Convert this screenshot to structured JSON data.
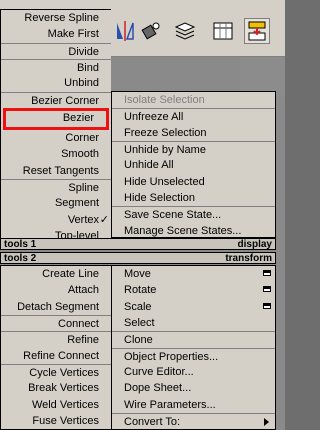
{
  "quad_menu": {
    "top_left": {
      "items": [
        {
          "label": "Reverse Spline"
        },
        {
          "label": "Make First"
        },
        {
          "label": "Divide"
        },
        {
          "label": "Bind"
        },
        {
          "label": "Unbind"
        },
        {
          "label": "Bezier Corner"
        },
        {
          "label": "Bezier"
        },
        {
          "label": "Corner"
        },
        {
          "label": "Smooth"
        },
        {
          "label": "Reset Tangents"
        },
        {
          "label": "Spline"
        },
        {
          "label": "Segment"
        },
        {
          "label": "Vertex",
          "check": "✓"
        },
        {
          "label": "Top-level"
        }
      ]
    },
    "top_right": {
      "items": [
        {
          "label": "Isolate Selection"
        },
        {
          "label": "Unfreeze All"
        },
        {
          "label": "Freeze Selection"
        },
        {
          "label": "Unhide by Name"
        },
        {
          "label": "Unhide All"
        },
        {
          "label": "Hide Unselected"
        },
        {
          "label": "Hide Selection"
        },
        {
          "label": "Save Scene State..."
        },
        {
          "label": "Manage Scene States..."
        }
      ]
    },
    "headers": {
      "tools1": "tools 1",
      "display": "display",
      "tools2": "tools 2",
      "transform": "transform"
    },
    "bottom_left": {
      "items": [
        {
          "label": "Create Line"
        },
        {
          "label": "Attach"
        },
        {
          "label": "Detach Segment"
        },
        {
          "label": "Connect"
        },
        {
          "label": "Refine"
        },
        {
          "label": "Refine Connect"
        },
        {
          "label": "Cycle Vertices"
        },
        {
          "label": "Break Vertices"
        },
        {
          "label": "Weld Vertices"
        },
        {
          "label": "Fuse Vertices"
        }
      ]
    },
    "bottom_right": {
      "items": [
        {
          "label": "Move"
        },
        {
          "label": "Rotate"
        },
        {
          "label": "Scale"
        },
        {
          "label": "Select"
        },
        {
          "label": "Clone"
        },
        {
          "label": "Object Properties..."
        },
        {
          "label": "Curve Editor..."
        },
        {
          "label": "Dope Sheet..."
        },
        {
          "label": "Wire Parameters..."
        },
        {
          "label": "Convert To:"
        }
      ]
    }
  },
  "toolbar": {
    "icons": [
      "mirror-icon",
      "align-icon",
      "layers-icon",
      "curve-editor-icon",
      "schematic-view-icon"
    ]
  },
  "highlight_color": "#ee1111"
}
